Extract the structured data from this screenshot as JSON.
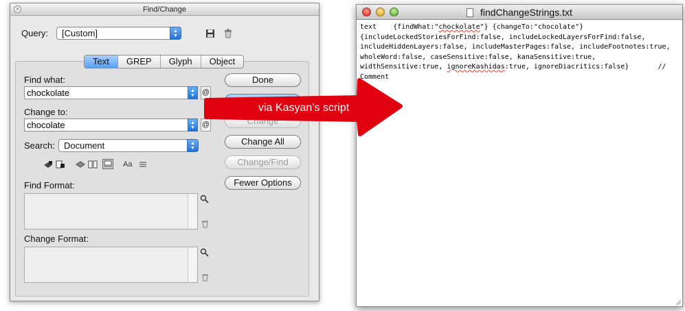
{
  "dialog": {
    "title": "Find/Change",
    "close_glyph": "×",
    "query_label": "Query:",
    "query_value": "[Custom]",
    "save_icon": "floppy-disk",
    "delete_icon": "trash",
    "tabs": [
      "Text",
      "GREP",
      "Glyph",
      "Object"
    ],
    "active_tab": "Text",
    "find_what_label": "Find what:",
    "find_what_value": "chockolate",
    "change_to_label": "Change to:",
    "change_to_value": "chocolate",
    "special_char_glyph": "@",
    "search_label": "Search:",
    "search_value": "Document",
    "case_glyph": "Aa",
    "find_format_label": "Find Format:",
    "change_format_label": "Change Format:",
    "buttons": {
      "done": "Done",
      "find": "Find",
      "change": "Change",
      "change_all": "Change All",
      "change_find": "Change/Find",
      "fewer_options": "Fewer Options"
    }
  },
  "annotation": {
    "label": "via Kasyan’s script",
    "color": "#e0000f"
  },
  "textedit": {
    "title": "findChangeStrings.txt",
    "lines": [
      [
        "text    {findWhat:\"",
        {
          "sq": "chockolate"
        },
        "\"} {changeTo:\"chocolate\"}"
      ],
      [
        "{includeLockedStoriesForFind:false, includeLockedLayersForFind:false,"
      ],
      [
        "includeHiddenLayers:false, includeMasterPages:false, includeFootnotes:true,"
      ],
      [
        "wholeWord:false, caseSensitive:false, kanaSensitive:true,"
      ],
      [
        "widthSensitive:true, ",
        {
          "sq": "ignoreKashidas"
        },
        ":true, ignoreDiacritics:false}       //"
      ],
      [
        "Comment"
      ]
    ]
  }
}
